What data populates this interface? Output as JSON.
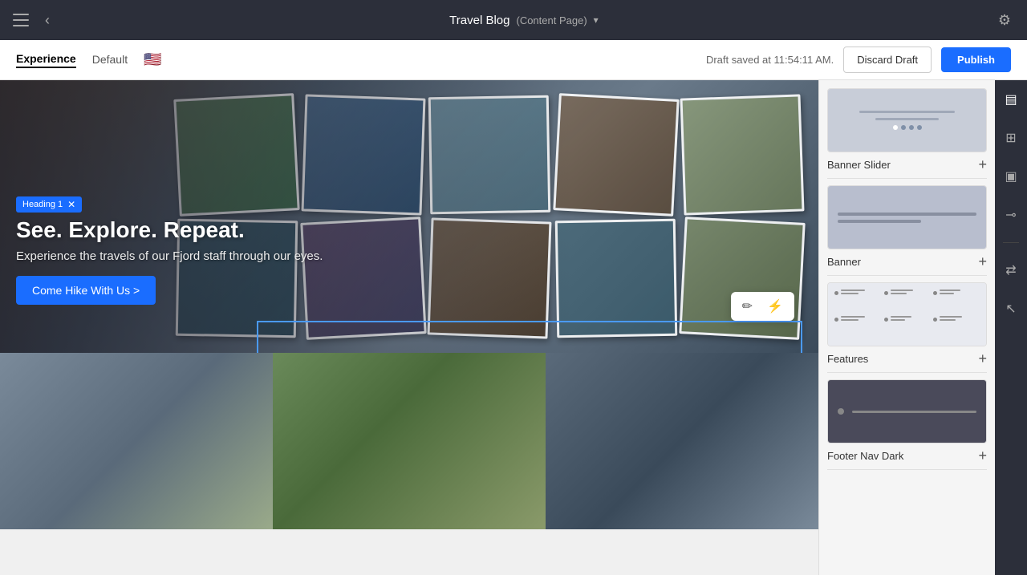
{
  "topBar": {
    "title": "Travel Blog",
    "pageType": "(Content Page)",
    "gearIcon": "⚙",
    "backIcon": "‹",
    "sidebarIcon": "☰",
    "dropdownArrow": "▾"
  },
  "secondaryBar": {
    "tabs": [
      {
        "label": "Experience",
        "active": true
      },
      {
        "label": "Default",
        "active": false
      }
    ],
    "flagEmoji": "🇺🇸",
    "draftStatus": "Draft saved at 11:54:11 AM.",
    "discardLabel": "Discard Draft",
    "publishLabel": "Publish"
  },
  "hero": {
    "headingBadge": "Heading 1",
    "heading": "See. Explore. Repeat.",
    "subtext": "Experience the travels of our Fjord staff through our eyes.",
    "ctaLabel": "Come Hike With Us >"
  },
  "editToolbar": {
    "editIcon": "✏",
    "flashIcon": "⚡"
  },
  "sidebar": {
    "blocks": [
      {
        "label": "Banner Slider",
        "addIcon": "+",
        "thumbType": "banner-slider"
      },
      {
        "label": "Banner",
        "addIcon": "+",
        "thumbType": "banner"
      },
      {
        "label": "Features",
        "addIcon": "+",
        "thumbType": "features"
      },
      {
        "label": "Footer Nav Dark",
        "addIcon": "+",
        "thumbType": "footer-dark"
      }
    ]
  },
  "iconBar": {
    "icons": [
      {
        "name": "layers-icon",
        "symbol": "▤",
        "active": true
      },
      {
        "name": "grid-icon",
        "symbol": "⊞",
        "active": false
      },
      {
        "name": "page-icon",
        "symbol": "▣",
        "active": false
      },
      {
        "name": "tree-icon",
        "symbol": "⊸",
        "active": false
      },
      {
        "name": "divider",
        "type": "divider"
      },
      {
        "name": "arrow-icon",
        "symbol": "⇄",
        "active": false
      },
      {
        "name": "cursor-icon",
        "symbol": "↖",
        "active": false
      }
    ]
  }
}
